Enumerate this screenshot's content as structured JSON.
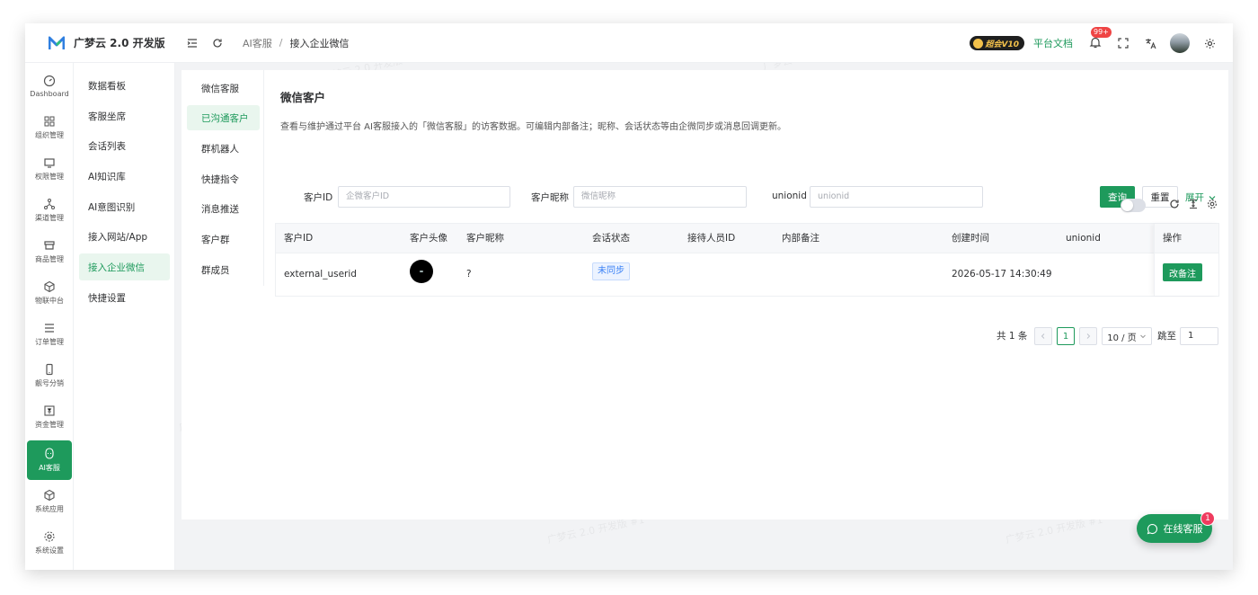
{
  "app": {
    "title": "广梦云 2.0 开发版"
  },
  "header": {
    "breadcrumb": [
      "AI客服",
      "接入企业微信"
    ],
    "vip_badge": "超会V10",
    "docs_link": "平台文档",
    "notification_count": "99+"
  },
  "rail": {
    "items": [
      {
        "label": "Dashboard",
        "icon": "dashboard-icon"
      },
      {
        "label": "组织管理",
        "icon": "grid-icon"
      },
      {
        "label": "权限管理",
        "icon": "monitor-icon"
      },
      {
        "label": "渠道管理",
        "icon": "network-icon"
      },
      {
        "label": "商品管理",
        "icon": "store-icon"
      },
      {
        "label": "物联中台",
        "icon": "cube-icon"
      },
      {
        "label": "订单管理",
        "icon": "list-icon"
      },
      {
        "label": "靓号分销",
        "icon": "phone-icon"
      },
      {
        "label": "资金管理",
        "icon": "yuan-icon"
      },
      {
        "label": "AI客服",
        "icon": "robot-icon"
      },
      {
        "label": "系统应用",
        "icon": "box-icon"
      },
      {
        "label": "系统设置",
        "icon": "gear-icon"
      }
    ],
    "active_index": 9
  },
  "submenu": {
    "items": [
      "数据看板",
      "客服坐席",
      "会话列表",
      "AI知识库",
      "AI意图识别",
      "接入网站/App",
      "接入企业微信",
      "快捷设置"
    ],
    "active_index": 6
  },
  "tertiary": {
    "items": [
      "微信客服",
      "已沟通客户",
      "群机器人",
      "快捷指令",
      "消息推送",
      "客户群",
      "群成员"
    ],
    "active_index": 1
  },
  "panel": {
    "title": "微信客户",
    "description": "查看与维护通过平台 AI客服接入的「微信客服」的访客数据。可编辑内部备注；昵称、会话状态等由企微同步或消息回调更新。"
  },
  "filters": {
    "customer_id": {
      "label": "客户ID",
      "placeholder": "企微客户ID"
    },
    "nickname": {
      "label": "客户昵称",
      "placeholder": "微信昵称"
    },
    "unionid": {
      "label": "unionid",
      "placeholder": "unionid"
    },
    "query_button": "查询",
    "reset_button": "重置",
    "expand_link": "展开"
  },
  "table": {
    "columns": [
      "客户ID",
      "客户头像",
      "客户昵称",
      "会话状态",
      "接待人员ID",
      "内部备注",
      "创建时间",
      "unionid",
      "操作"
    ],
    "rows": [
      {
        "customer_id": "external_userid",
        "nickname": "?",
        "status": "未同步",
        "staff_id": "",
        "remark": "",
        "created_at": "2026-05-17 14:30:49",
        "unionid": "",
        "action": "改备注"
      }
    ]
  },
  "pagination": {
    "total_text": "共 1 条",
    "current_page": "1",
    "page_size": "10 / 页",
    "jump_label": "跳至",
    "jump_value": "1"
  },
  "chat_fab": {
    "label": "在线客服",
    "badge": "1"
  },
  "watermark": "广梦云 2.0 开发版 #1",
  "colors": {
    "primary": "#1e9a5c",
    "badge_red": "#ef4444",
    "tag_blue": "#3b82f6"
  }
}
